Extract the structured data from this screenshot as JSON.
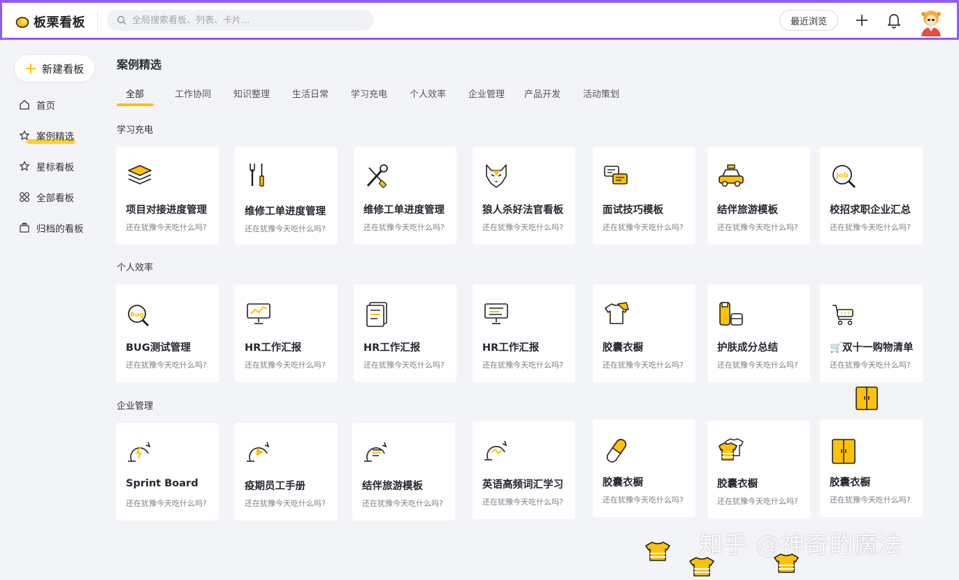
{
  "app": {
    "name": "板栗看板",
    "accent": "#ffc107",
    "frame": "#8b5cf6"
  },
  "search": {
    "placeholder": "全局搜索看板、列表、卡片..."
  },
  "header": {
    "recent_label": "最近浏览"
  },
  "sidebar": {
    "new_board_label": "新建看板",
    "items": [
      {
        "label": "首页",
        "icon": "home-icon"
      },
      {
        "label": "案例精选",
        "icon": "star-icon"
      },
      {
        "label": "星标看板",
        "icon": "star-outline-icon"
      },
      {
        "label": "全部看板",
        "icon": "grid-icon"
      },
      {
        "label": "归档的看板",
        "icon": "archive-icon"
      }
    ]
  },
  "main": {
    "title": "案例精选",
    "tabs": [
      {
        "label": "全部"
      },
      {
        "label": "工作协同"
      },
      {
        "label": "知识整理"
      },
      {
        "label": "生活日常"
      },
      {
        "label": "学习充电"
      },
      {
        "label": "个人效率"
      },
      {
        "label": "企业管理"
      },
      {
        "label": "产品开发"
      },
      {
        "label": "活动策划"
      }
    ],
    "sections": [
      {
        "title": "学习充电",
        "cards": [
          {
            "title": "项目对接进度管理",
            "subtitle": "还在犹豫今天吃什么吗?",
            "icon": "layers-icon"
          },
          {
            "title": "维修工单进度管理",
            "subtitle": "还在犹豫今天吃什么吗?",
            "icon": "tools-icon"
          },
          {
            "title": "维修工单进度管理",
            "subtitle": "还在犹豫今天吃什么吗?",
            "icon": "wrench-screwdriver-icon"
          },
          {
            "title": "狼人杀好法官看板",
            "subtitle": "还在犹豫今天吃什么吗?",
            "icon": "wolf-icon"
          },
          {
            "title": "面试技巧模板",
            "subtitle": "还在犹豫今天吃什么吗?",
            "icon": "chat-icon"
          },
          {
            "title": "结伴旅游模板",
            "subtitle": "还在犹豫今天吃什么吗?",
            "icon": "taxi-icon"
          },
          {
            "title": "校招求职企业汇总",
            "subtitle": "还在犹豫今天吃什么吗?",
            "icon": "job-search-icon"
          }
        ]
      },
      {
        "title": "个人效率",
        "cards": [
          {
            "title": "BUG测试管理",
            "subtitle": "还在犹豫今天吃什么吗?",
            "icon": "bug-search-icon"
          },
          {
            "title": "HR工作汇报",
            "subtitle": "还在犹豫今天吃什么吗?",
            "icon": "presentation-chart-icon"
          },
          {
            "title": "HR工作汇报",
            "subtitle": "还在犹豫今天吃什么吗?",
            "icon": "document-list-icon"
          },
          {
            "title": "HR工作汇报",
            "subtitle": "还在犹豫今天吃什么吗?",
            "icon": "presentation-board-icon"
          },
          {
            "title": "胶囊衣橱",
            "subtitle": "还在犹豫今天吃什么吗?",
            "icon": "tshirt-icon"
          },
          {
            "title": "护肤成分总结",
            "subtitle": "还在犹豫今天吃什么吗?",
            "icon": "skincare-icon"
          },
          {
            "title": "🛒双十一购物清单",
            "subtitle": "还在犹豫今天吃什么吗?",
            "icon": "cart-icon"
          }
        ]
      },
      {
        "title": "企业管理",
        "cards": [
          {
            "title": "Sprint Board",
            "subtitle": "还在犹豫今天吃什么吗?",
            "icon": "sprint-bolt-icon"
          },
          {
            "title": "疫期员工手册",
            "subtitle": "还在犹豫今天吃什么吗?",
            "icon": "sprint-play-icon"
          },
          {
            "title": "结伴旅游模板",
            "subtitle": "还在犹豫今天吃什么吗?",
            "icon": "sprint-list-icon"
          },
          {
            "title": "英语高频词汇学习",
            "subtitle": "还在犹豫今天吃什么吗?",
            "icon": "sprint-chart-icon"
          },
          {
            "title": "胶囊衣橱",
            "subtitle": "还在犹豫今天吃什么吗?",
            "icon": "capsule-icon"
          },
          {
            "title": "胶囊衣橱",
            "subtitle": "还在犹豫今天吃什么吗?",
            "icon": "tshirts-icon"
          },
          {
            "title": "胶囊衣橱",
            "subtitle": "还在犹豫今天吃什么吗?",
            "icon": "wardrobe-icon"
          }
        ]
      }
    ]
  },
  "watermark": "知乎 @神奇的魔法"
}
